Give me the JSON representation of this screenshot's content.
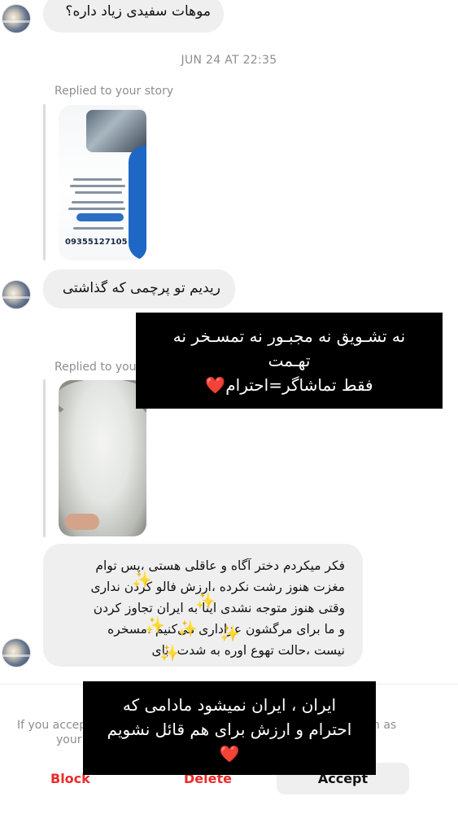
{
  "messages": {
    "msg1_text": "موهات سفیدی زیاد داره؟",
    "timestamp": "JUN 24 AT 22:35",
    "replied_label_1": "Replied to your story",
    "story1": {
      "phone": "09355127105"
    },
    "msg2_text": "ریدیم تو پرچمی که گذاشتی",
    "replied_label_2": "Replied to you",
    "msg3_lines": [
      "فکر میکردم دختر آگاه و عاقلی هستی ،پس توام",
      "مغزت هنوز رشت نکرده ،ارزش فالو کردن نداری",
      "وقتی هنوز متوجه نشدی اینا به ایران تجاوز کردن",
      "و ما برای مرگشون عزاداری می‌کنیم ،مسخره",
      "نیست ،حالت تهوع اوره به شدت ،بای"
    ]
  },
  "overlays": {
    "top_lines": [
      "نه تشـویق نه مجبـور نه تمسـخر نه",
      "تهـمت",
      "فقط تماشاگر=احترام❤️"
    ],
    "bottom_lines": [
      "ایران ، ایران نمیشود مادامی که",
      "احترام و ارزش برای هم قائل نشویم",
      "❤️"
    ]
  },
  "request_bar": {
    "notice_left": "If you accep",
    "notice_left2": "your",
    "notice_right": "n as",
    "block_label": "Block",
    "delete_label": "Delete",
    "accept_label": "Accept"
  },
  "icons": {
    "avatar": "profile-avatar",
    "sparkle": "sparkle-emoji"
  },
  "colors": {
    "bubble": "#efefef",
    "danger": "#ed2a2a",
    "muted": "#8e8e8e"
  }
}
